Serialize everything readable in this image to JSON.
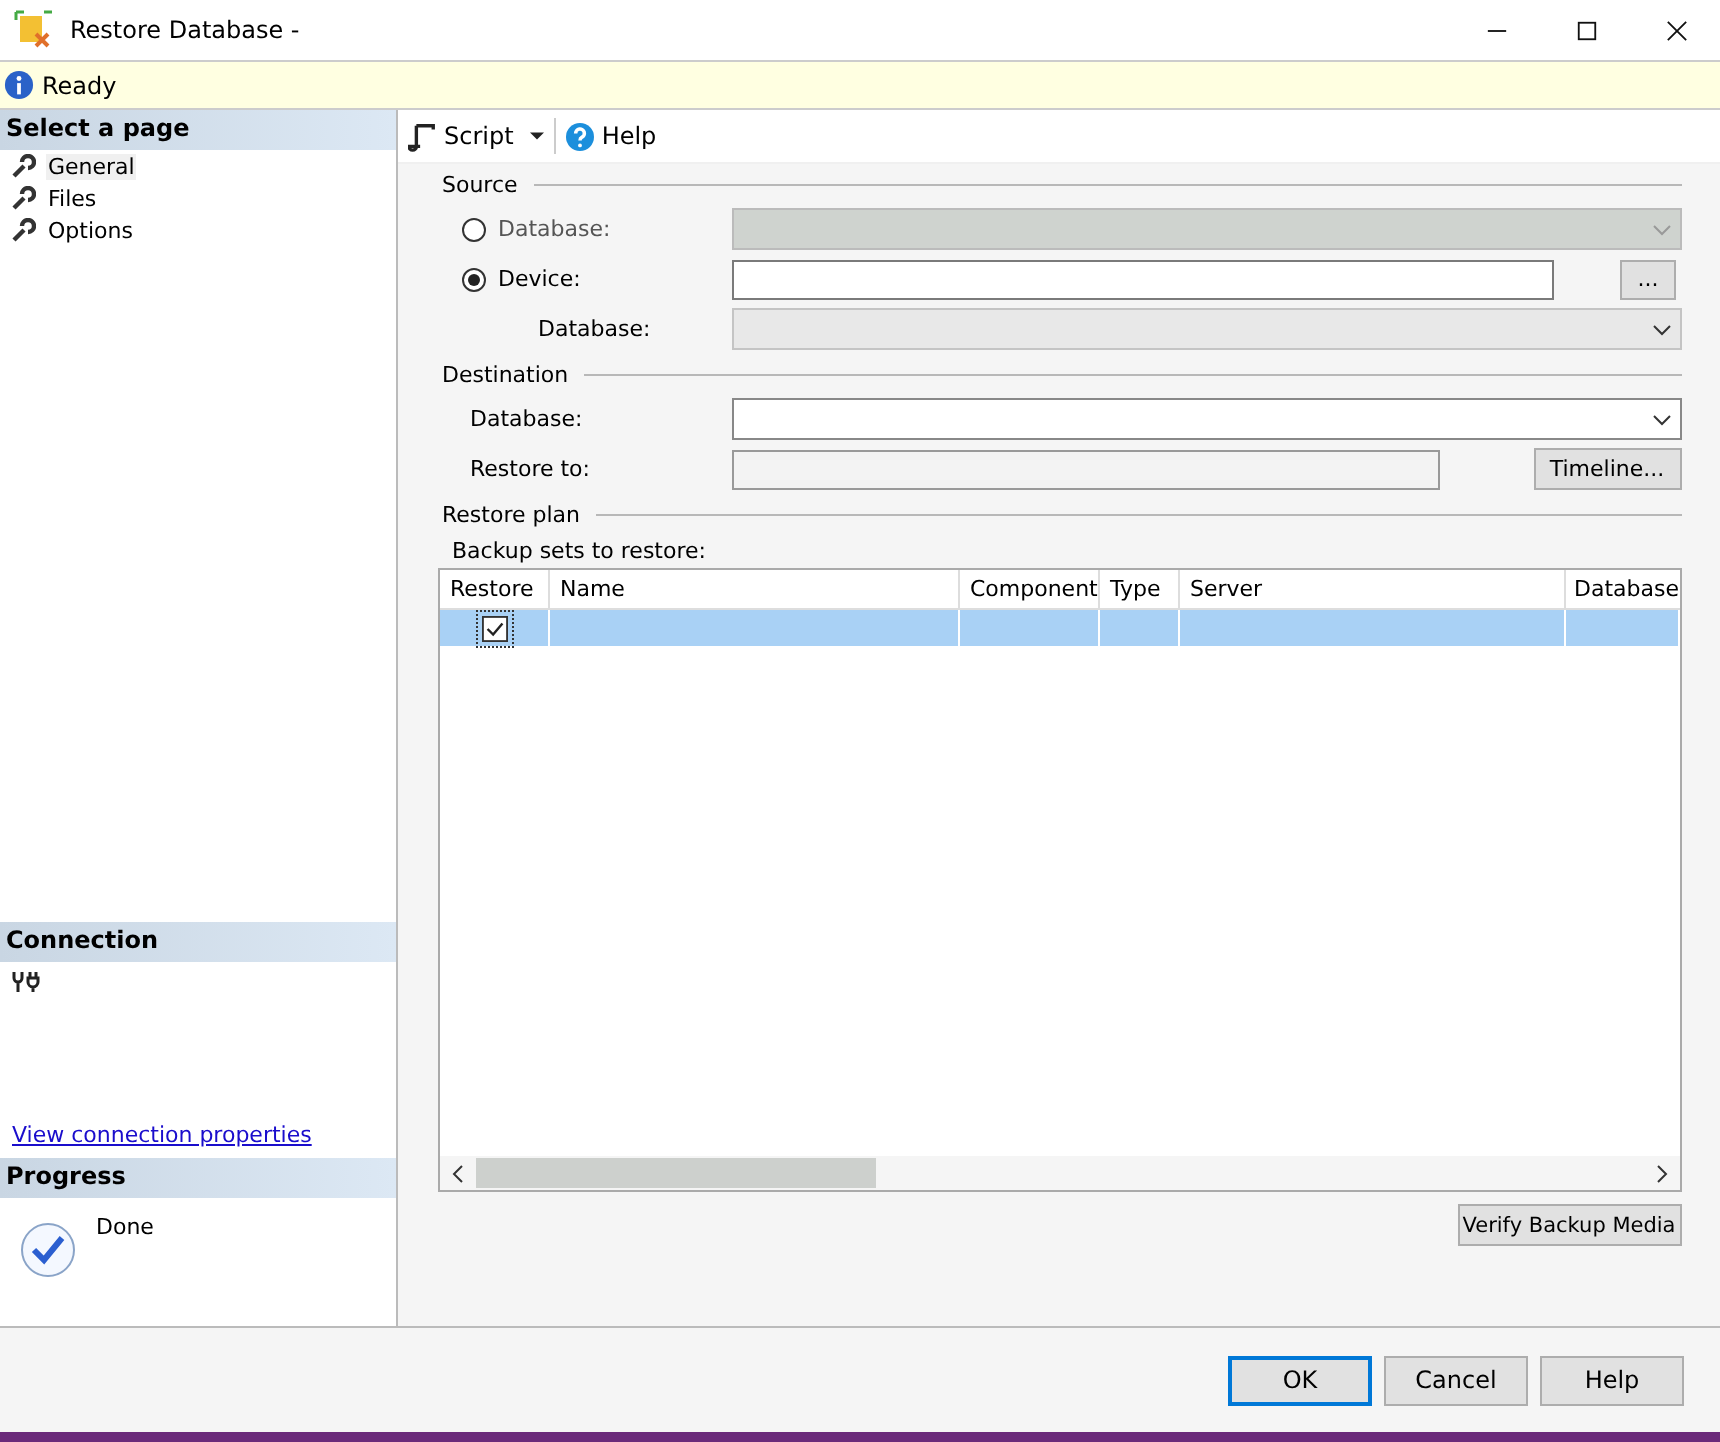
{
  "window": {
    "title": "Restore Database -"
  },
  "status": {
    "text": "Ready"
  },
  "sidebar": {
    "heading": "Select a page",
    "items": [
      {
        "label": "General",
        "selected": true
      },
      {
        "label": "Files",
        "selected": false
      },
      {
        "label": "Options",
        "selected": false
      }
    ]
  },
  "connection": {
    "heading": "Connection",
    "link": "View connection properties"
  },
  "progress": {
    "heading": "Progress",
    "status": "Done"
  },
  "toolbar": {
    "script": "Script",
    "help": "Help"
  },
  "source": {
    "title": "Source",
    "options": [
      {
        "label": "Database:",
        "selected": false,
        "disabled": true
      },
      {
        "label": "Device:",
        "selected": true
      }
    ],
    "device_database_label": "Database:",
    "browse": "..."
  },
  "destination": {
    "title": "Destination",
    "database_label": "Database:",
    "restore_to_label": "Restore to:",
    "timeline": "Timeline..."
  },
  "plan": {
    "title": "Restore plan",
    "grid_label": "Backup sets to restore:",
    "columns": [
      "Restore",
      "Name",
      "Component",
      "Type",
      "Server",
      "Database"
    ],
    "rows": [
      {
        "restore": true,
        "selected": true
      }
    ]
  },
  "verify": "Verify Backup Media",
  "buttons": [
    {
      "label": "OK",
      "default": true
    },
    {
      "label": "Cancel",
      "default": false
    },
    {
      "label": "Help",
      "default": false
    }
  ]
}
